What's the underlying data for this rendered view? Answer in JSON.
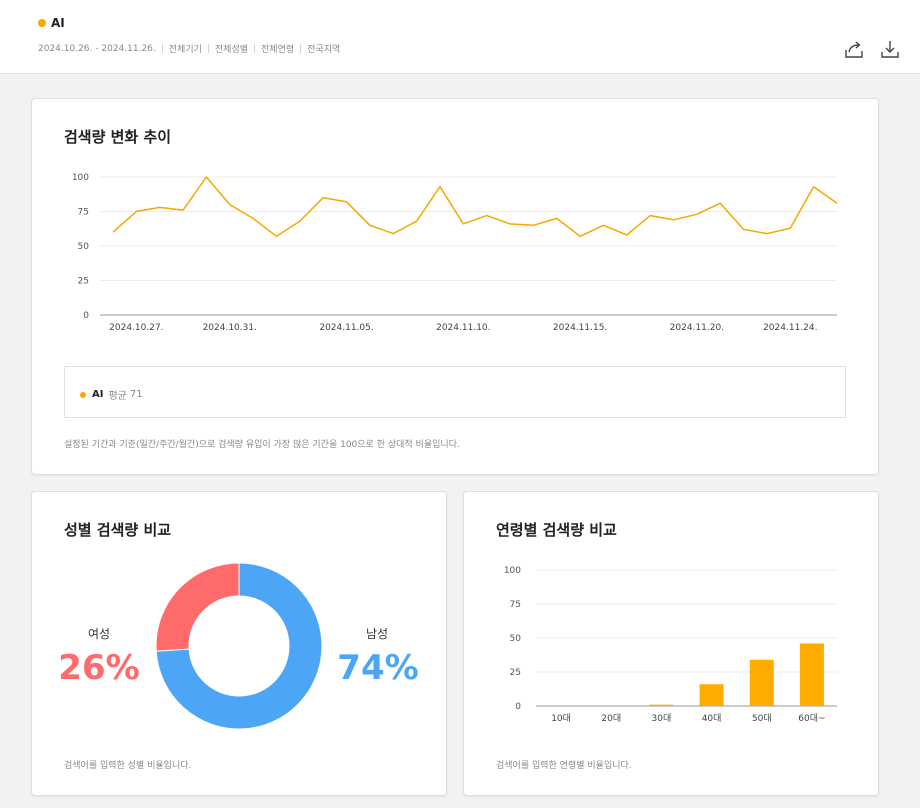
{
  "header": {
    "keyword": "AI",
    "filters": [
      "2024.10.26. - 2024.11.26.",
      "전체기기",
      "전체성별",
      "전체연령",
      "전국지역"
    ],
    "share_icon": "share-icon",
    "download_icon": "download-icon"
  },
  "trend": {
    "title": "검색량 변화 추이",
    "legend_name": "AI",
    "legend_avg_label": "평균",
    "legend_avg": "71",
    "note": "설정된 기간과 기준(일간/주간/월간)으로 검색량 유입이 가장 많은 기간을 100으로 한 상대적 비율입니다."
  },
  "gender": {
    "title": "성별 검색량 비교",
    "female_label": "여성",
    "female_pct": "26%",
    "male_label": "남성",
    "male_pct": "74%",
    "note": "검색어를 입력한 성별 비율입니다."
  },
  "age": {
    "title": "연령별 검색량 비교",
    "note": "검색어를 입력한 연령별 비율입니다."
  },
  "colors": {
    "line": "#f5a800",
    "bar": "#ffab00",
    "female": "#ff6b6b",
    "male": "#4da6f5"
  },
  "chart_data": [
    {
      "type": "line",
      "title": "검색량 변화 추이",
      "x": [
        "2024.10.26.",
        "2024.10.27.",
        "2024.10.28.",
        "2024.10.29.",
        "2024.10.30.",
        "2024.10.31.",
        "2024.11.01.",
        "2024.11.02.",
        "2024.11.03.",
        "2024.11.04.",
        "2024.11.05.",
        "2024.11.06.",
        "2024.11.07.",
        "2024.11.08.",
        "2024.11.09.",
        "2024.11.10.",
        "2024.11.11.",
        "2024.11.12.",
        "2024.11.13.",
        "2024.11.14.",
        "2024.11.15.",
        "2024.11.16.",
        "2024.11.17.",
        "2024.11.18.",
        "2024.11.19.",
        "2024.11.20.",
        "2024.11.21.",
        "2024.11.22.",
        "2024.11.23.",
        "2024.11.24.",
        "2024.11.25.",
        "2024.11.26."
      ],
      "xtick_labels": [
        "2024.10.27.",
        "2024.10.31.",
        "2024.11.05.",
        "2024.11.10.",
        "2024.11.15.",
        "2024.11.20.",
        "2024.11.24."
      ],
      "xtick_index": [
        1,
        5,
        10,
        15,
        20,
        25,
        29
      ],
      "series": [
        {
          "name": "AI",
          "values": [
            60,
            75,
            78,
            76,
            100,
            80,
            70,
            57,
            68,
            85,
            82,
            65,
            59,
            68,
            93,
            66,
            72,
            66,
            65,
            70,
            57,
            65,
            58,
            72,
            69,
            73,
            81,
            62,
            59,
            63,
            93,
            81
          ]
        }
      ],
      "yticks": [
        0,
        25,
        50,
        75,
        100
      ],
      "ylim": [
        0,
        100
      ],
      "grid": true
    },
    {
      "type": "pie",
      "title": "성별 검색량 비교",
      "labels": [
        "여성",
        "남성"
      ],
      "values": [
        26,
        74
      ]
    },
    {
      "type": "bar",
      "title": "연령별 검색량 비교",
      "categories": [
        "10대",
        "20대",
        "30대",
        "40대",
        "50대",
        "60대~"
      ],
      "values": [
        0,
        0,
        1,
        16,
        34,
        46
      ],
      "yticks": [
        0,
        25,
        50,
        75,
        100
      ],
      "ylim": [
        0,
        100
      ],
      "grid": true
    }
  ]
}
